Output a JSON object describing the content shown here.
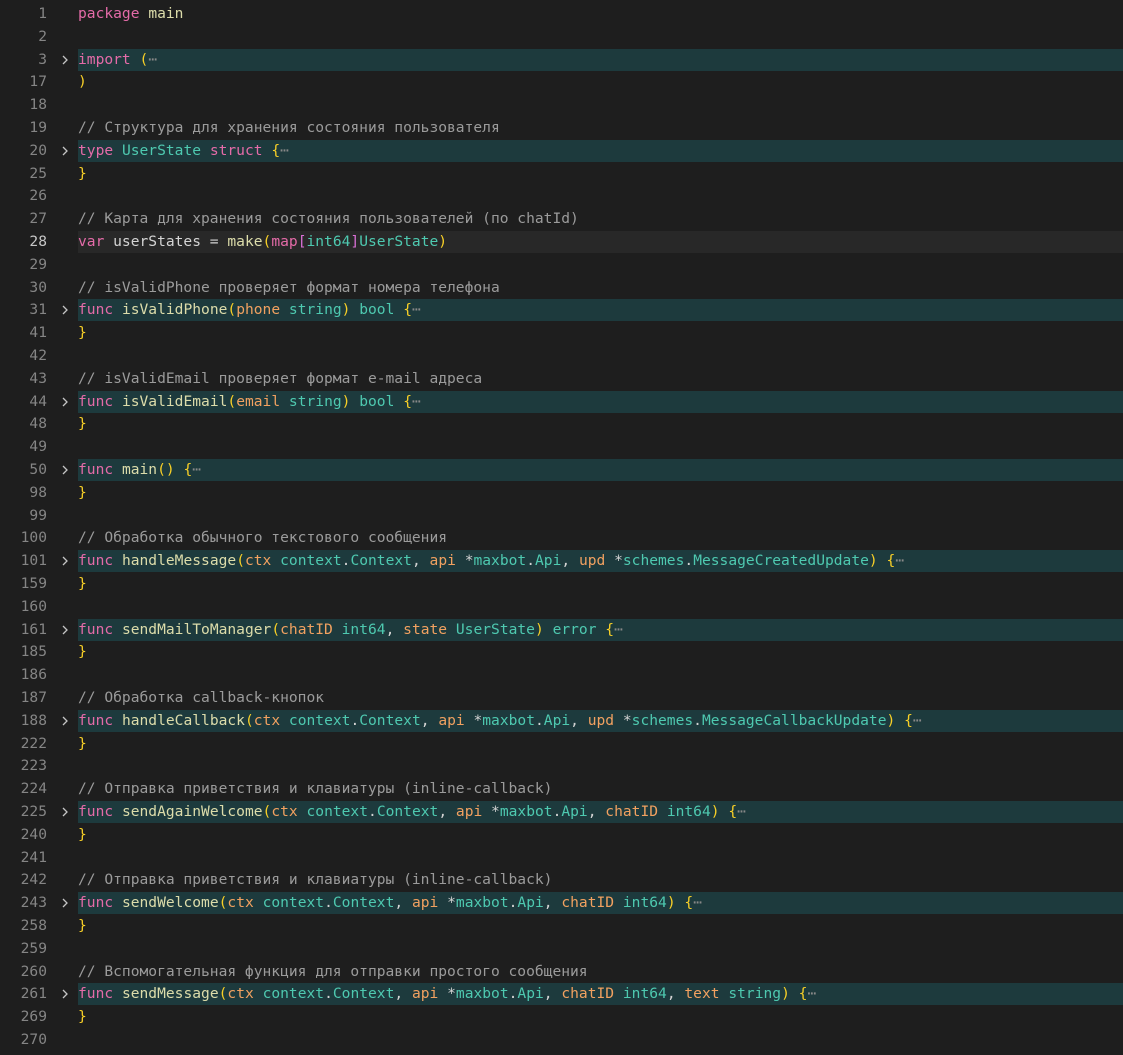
{
  "editor": {
    "language": "go",
    "colors": {
      "background": "#1e1e1e",
      "fold_highlight": "#1d3a3d",
      "current_line": "#282828",
      "keyword": "#e46ba8",
      "function": "#dcdcaa",
      "type": "#4ec9b0",
      "parameter": "#f1a160",
      "comment": "#9b9b9b",
      "brace": "#f7cf27"
    },
    "lines": [
      {
        "num": "1",
        "fold": false,
        "tokens": [
          [
            "kw",
            "package"
          ],
          [
            "plain",
            " "
          ],
          [
            "fn",
            "main"
          ]
        ]
      },
      {
        "num": "2",
        "fold": false,
        "tokens": []
      },
      {
        "num": "3",
        "fold": true,
        "tokens": [
          [
            "kw",
            "import"
          ],
          [
            "plain",
            " "
          ],
          [
            "paren",
            "("
          ],
          [
            "ellipsis",
            "⋯"
          ]
        ]
      },
      {
        "num": "17",
        "fold": false,
        "tokens": [
          [
            "paren",
            ")"
          ]
        ]
      },
      {
        "num": "18",
        "fold": false,
        "tokens": []
      },
      {
        "num": "19",
        "fold": false,
        "tokens": [
          [
            "comment",
            "// Структура для хранения состояния пользователя"
          ]
        ]
      },
      {
        "num": "20",
        "fold": true,
        "tokens": [
          [
            "kw",
            "type"
          ],
          [
            "plain",
            " "
          ],
          [
            "type",
            "UserState"
          ],
          [
            "plain",
            " "
          ],
          [
            "kw",
            "struct"
          ],
          [
            "plain",
            " "
          ],
          [
            "brace",
            "{"
          ],
          [
            "ellipsis",
            "⋯"
          ]
        ]
      },
      {
        "num": "25",
        "fold": false,
        "tokens": [
          [
            "brace",
            "}"
          ]
        ]
      },
      {
        "num": "26",
        "fold": false,
        "tokens": []
      },
      {
        "num": "27",
        "fold": false,
        "tokens": [
          [
            "comment",
            "// Карта для хранения состояния пользователей (по chatId)"
          ]
        ]
      },
      {
        "num": "28",
        "fold": false,
        "current": true,
        "tokens": [
          [
            "kw",
            "var"
          ],
          [
            "plain",
            " userStates = "
          ],
          [
            "fn",
            "make"
          ],
          [
            "paren",
            "("
          ],
          [
            "map",
            "map"
          ],
          [
            "bracket",
            "["
          ],
          [
            "type",
            "int64"
          ],
          [
            "bracket",
            "]"
          ],
          [
            "type",
            "UserState"
          ],
          [
            "paren",
            ")"
          ]
        ]
      },
      {
        "num": "29",
        "fold": false,
        "tokens": []
      },
      {
        "num": "30",
        "fold": false,
        "tokens": [
          [
            "comment",
            "// isValidPhone проверяет формат номера телефона"
          ]
        ]
      },
      {
        "num": "31",
        "fold": true,
        "tokens": [
          [
            "kw",
            "func"
          ],
          [
            "plain",
            " "
          ],
          [
            "fn",
            "isValidPhone"
          ],
          [
            "paren",
            "("
          ],
          [
            "param",
            "phone"
          ],
          [
            "plain",
            " "
          ],
          [
            "type",
            "string"
          ],
          [
            "paren",
            ")"
          ],
          [
            "plain",
            " "
          ],
          [
            "type",
            "bool"
          ],
          [
            "plain",
            " "
          ],
          [
            "brace",
            "{"
          ],
          [
            "ellipsis",
            "⋯"
          ]
        ]
      },
      {
        "num": "41",
        "fold": false,
        "tokens": [
          [
            "brace",
            "}"
          ]
        ]
      },
      {
        "num": "42",
        "fold": false,
        "tokens": []
      },
      {
        "num": "43",
        "fold": false,
        "tokens": [
          [
            "comment",
            "// isValidEmail проверяет формат e-mail адреса"
          ]
        ]
      },
      {
        "num": "44",
        "fold": true,
        "tokens": [
          [
            "kw",
            "func"
          ],
          [
            "plain",
            " "
          ],
          [
            "fn",
            "isValidEmail"
          ],
          [
            "paren",
            "("
          ],
          [
            "param",
            "email"
          ],
          [
            "plain",
            " "
          ],
          [
            "type",
            "string"
          ],
          [
            "paren",
            ")"
          ],
          [
            "plain",
            " "
          ],
          [
            "type",
            "bool"
          ],
          [
            "plain",
            " "
          ],
          [
            "brace",
            "{"
          ],
          [
            "ellipsis",
            "⋯"
          ]
        ]
      },
      {
        "num": "48",
        "fold": false,
        "tokens": [
          [
            "brace",
            "}"
          ]
        ]
      },
      {
        "num": "49",
        "fold": false,
        "tokens": []
      },
      {
        "num": "50",
        "fold": true,
        "tokens": [
          [
            "kw",
            "func"
          ],
          [
            "plain",
            " "
          ],
          [
            "fn",
            "main"
          ],
          [
            "paren",
            "()"
          ],
          [
            "plain",
            " "
          ],
          [
            "brace",
            "{"
          ],
          [
            "ellipsis",
            "⋯"
          ]
        ]
      },
      {
        "num": "98",
        "fold": false,
        "tokens": [
          [
            "brace",
            "}"
          ]
        ]
      },
      {
        "num": "99",
        "fold": false,
        "tokens": []
      },
      {
        "num": "100",
        "fold": false,
        "tokens": [
          [
            "comment",
            "// Обработка обычного текстового сообщения"
          ]
        ]
      },
      {
        "num": "101",
        "fold": true,
        "tokens": [
          [
            "kw",
            "func"
          ],
          [
            "plain",
            " "
          ],
          [
            "fn",
            "handleMessage"
          ],
          [
            "paren",
            "("
          ],
          [
            "param",
            "ctx"
          ],
          [
            "plain",
            " "
          ],
          [
            "id",
            "context"
          ],
          [
            "plain",
            "."
          ],
          [
            "type",
            "Context"
          ],
          [
            "plain",
            ", "
          ],
          [
            "param",
            "api"
          ],
          [
            "plain",
            " *"
          ],
          [
            "id",
            "maxbot"
          ],
          [
            "plain",
            "."
          ],
          [
            "type",
            "Api"
          ],
          [
            "plain",
            ", "
          ],
          [
            "param",
            "upd"
          ],
          [
            "plain",
            " *"
          ],
          [
            "id",
            "schemes"
          ],
          [
            "plain",
            "."
          ],
          [
            "type",
            "MessageCreatedUpdate"
          ],
          [
            "paren",
            ")"
          ],
          [
            "plain",
            " "
          ],
          [
            "brace",
            "{"
          ],
          [
            "ellipsis",
            "⋯"
          ]
        ]
      },
      {
        "num": "159",
        "fold": false,
        "tokens": [
          [
            "brace",
            "}"
          ]
        ]
      },
      {
        "num": "160",
        "fold": false,
        "tokens": []
      },
      {
        "num": "161",
        "fold": true,
        "tokens": [
          [
            "kw",
            "func"
          ],
          [
            "plain",
            " "
          ],
          [
            "fn",
            "sendMailToManager"
          ],
          [
            "paren",
            "("
          ],
          [
            "param",
            "chatID"
          ],
          [
            "plain",
            " "
          ],
          [
            "type",
            "int64"
          ],
          [
            "plain",
            ", "
          ],
          [
            "param",
            "state"
          ],
          [
            "plain",
            " "
          ],
          [
            "type",
            "UserState"
          ],
          [
            "paren",
            ")"
          ],
          [
            "plain",
            " "
          ],
          [
            "type",
            "error"
          ],
          [
            "plain",
            " "
          ],
          [
            "brace",
            "{"
          ],
          [
            "ellipsis",
            "⋯"
          ]
        ]
      },
      {
        "num": "185",
        "fold": false,
        "tokens": [
          [
            "brace",
            "}"
          ]
        ]
      },
      {
        "num": "186",
        "fold": false,
        "tokens": []
      },
      {
        "num": "187",
        "fold": false,
        "tokens": [
          [
            "comment",
            "// Обработка callback-кнопок"
          ]
        ]
      },
      {
        "num": "188",
        "fold": true,
        "tokens": [
          [
            "kw",
            "func"
          ],
          [
            "plain",
            " "
          ],
          [
            "fn",
            "handleCallback"
          ],
          [
            "paren",
            "("
          ],
          [
            "param",
            "ctx"
          ],
          [
            "plain",
            " "
          ],
          [
            "id",
            "context"
          ],
          [
            "plain",
            "."
          ],
          [
            "type",
            "Context"
          ],
          [
            "plain",
            ", "
          ],
          [
            "param",
            "api"
          ],
          [
            "plain",
            " *"
          ],
          [
            "id",
            "maxbot"
          ],
          [
            "plain",
            "."
          ],
          [
            "type",
            "Api"
          ],
          [
            "plain",
            ", "
          ],
          [
            "param",
            "upd"
          ],
          [
            "plain",
            " *"
          ],
          [
            "id",
            "schemes"
          ],
          [
            "plain",
            "."
          ],
          [
            "type",
            "MessageCallbackUpdate"
          ],
          [
            "paren",
            ")"
          ],
          [
            "plain",
            " "
          ],
          [
            "brace",
            "{"
          ],
          [
            "ellipsis",
            "⋯"
          ]
        ]
      },
      {
        "num": "222",
        "fold": false,
        "tokens": [
          [
            "brace",
            "}"
          ]
        ]
      },
      {
        "num": "223",
        "fold": false,
        "tokens": []
      },
      {
        "num": "224",
        "fold": false,
        "tokens": [
          [
            "comment",
            "// Отправка приветствия и клавиатуры (inline-callback)"
          ]
        ]
      },
      {
        "num": "225",
        "fold": true,
        "tokens": [
          [
            "kw",
            "func"
          ],
          [
            "plain",
            " "
          ],
          [
            "fn",
            "sendAgainWelcome"
          ],
          [
            "paren",
            "("
          ],
          [
            "param",
            "ctx"
          ],
          [
            "plain",
            " "
          ],
          [
            "id",
            "context"
          ],
          [
            "plain",
            "."
          ],
          [
            "type",
            "Context"
          ],
          [
            "plain",
            ", "
          ],
          [
            "param",
            "api"
          ],
          [
            "plain",
            " *"
          ],
          [
            "id",
            "maxbot"
          ],
          [
            "plain",
            "."
          ],
          [
            "type",
            "Api"
          ],
          [
            "plain",
            ", "
          ],
          [
            "param",
            "chatID"
          ],
          [
            "plain",
            " "
          ],
          [
            "type",
            "int64"
          ],
          [
            "paren",
            ")"
          ],
          [
            "plain",
            " "
          ],
          [
            "brace",
            "{"
          ],
          [
            "ellipsis",
            "⋯"
          ]
        ]
      },
      {
        "num": "240",
        "fold": false,
        "tokens": [
          [
            "brace",
            "}"
          ]
        ]
      },
      {
        "num": "241",
        "fold": false,
        "tokens": []
      },
      {
        "num": "242",
        "fold": false,
        "tokens": [
          [
            "comment",
            "// Отправка приветствия и клавиатуры (inline-callback)"
          ]
        ]
      },
      {
        "num": "243",
        "fold": true,
        "tokens": [
          [
            "kw",
            "func"
          ],
          [
            "plain",
            " "
          ],
          [
            "fn",
            "sendWelcome"
          ],
          [
            "paren",
            "("
          ],
          [
            "param",
            "ctx"
          ],
          [
            "plain",
            " "
          ],
          [
            "id",
            "context"
          ],
          [
            "plain",
            "."
          ],
          [
            "type",
            "Context"
          ],
          [
            "plain",
            ", "
          ],
          [
            "param",
            "api"
          ],
          [
            "plain",
            " *"
          ],
          [
            "id",
            "maxbot"
          ],
          [
            "plain",
            "."
          ],
          [
            "type",
            "Api"
          ],
          [
            "plain",
            ", "
          ],
          [
            "param",
            "chatID"
          ],
          [
            "plain",
            " "
          ],
          [
            "type",
            "int64"
          ],
          [
            "paren",
            ")"
          ],
          [
            "plain",
            " "
          ],
          [
            "brace",
            "{"
          ],
          [
            "ellipsis",
            "⋯"
          ]
        ]
      },
      {
        "num": "258",
        "fold": false,
        "tokens": [
          [
            "brace",
            "}"
          ]
        ]
      },
      {
        "num": "259",
        "fold": false,
        "tokens": []
      },
      {
        "num": "260",
        "fold": false,
        "tokens": [
          [
            "comment",
            "// Вспомогательная функция для отправки простого сообщения"
          ]
        ]
      },
      {
        "num": "261",
        "fold": true,
        "tokens": [
          [
            "kw",
            "func"
          ],
          [
            "plain",
            " "
          ],
          [
            "fn",
            "sendMessage"
          ],
          [
            "paren",
            "("
          ],
          [
            "param",
            "ctx"
          ],
          [
            "plain",
            " "
          ],
          [
            "id",
            "context"
          ],
          [
            "plain",
            "."
          ],
          [
            "type",
            "Context"
          ],
          [
            "plain",
            ", "
          ],
          [
            "param",
            "api"
          ],
          [
            "plain",
            " *"
          ],
          [
            "id",
            "maxbot"
          ],
          [
            "plain",
            "."
          ],
          [
            "type",
            "Api"
          ],
          [
            "plain",
            ", "
          ],
          [
            "param",
            "chatID"
          ],
          [
            "plain",
            " "
          ],
          [
            "type",
            "int64"
          ],
          [
            "plain",
            ", "
          ],
          [
            "param",
            "text"
          ],
          [
            "plain",
            " "
          ],
          [
            "type",
            "string"
          ],
          [
            "paren",
            ")"
          ],
          [
            "plain",
            " "
          ],
          [
            "brace",
            "{"
          ],
          [
            "ellipsis",
            "⋯"
          ]
        ]
      },
      {
        "num": "269",
        "fold": false,
        "tokens": [
          [
            "brace",
            "}"
          ]
        ]
      },
      {
        "num": "270",
        "fold": false,
        "tokens": []
      }
    ]
  }
}
